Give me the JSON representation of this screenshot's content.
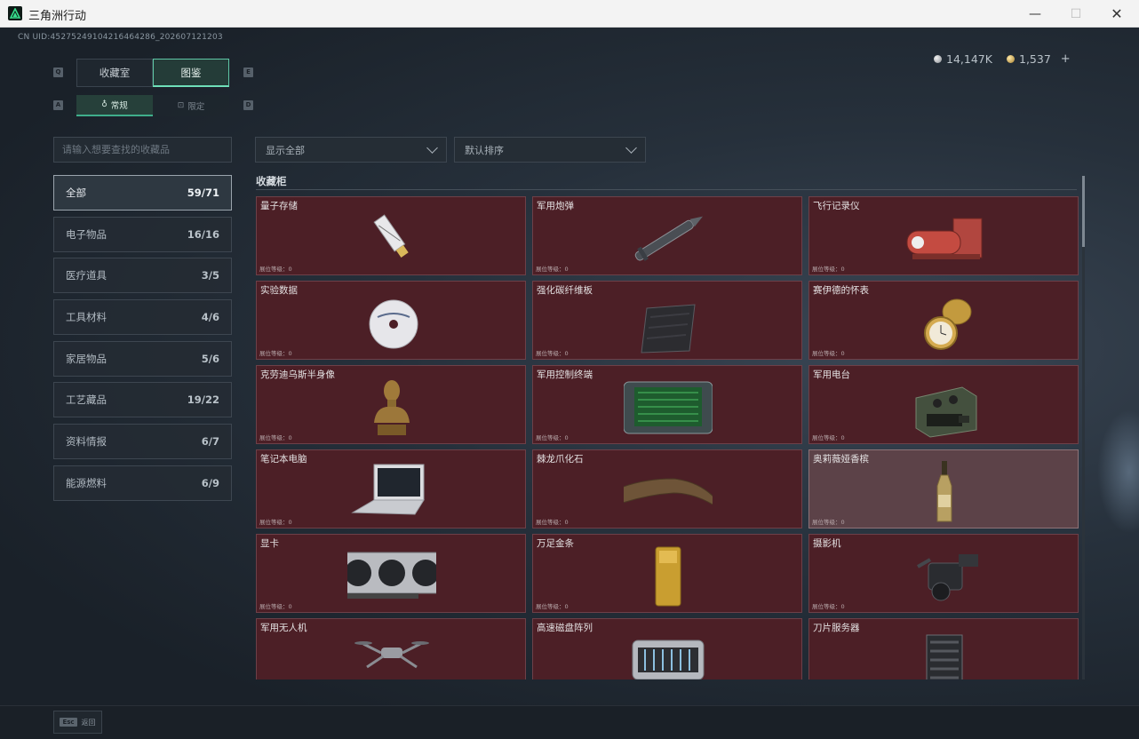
{
  "window": {
    "title": "三角洲行动",
    "min": "—",
    "max": "☐",
    "close": "✕"
  },
  "uid": "CN UID:45275249104216464286_202607121203",
  "currency": [
    {
      "value": "14,147K",
      "type": "silver"
    },
    {
      "value": "1,537",
      "type": "gold",
      "plus": "+"
    }
  ],
  "keybinds": {
    "q": "Q",
    "e": "E",
    "a": "A",
    "d": "D"
  },
  "tabs": [
    {
      "label": "收藏室"
    },
    {
      "label": "图鉴",
      "active": true
    }
  ],
  "subtabs": [
    {
      "label": "常规",
      "icon": "♁",
      "active": true
    },
    {
      "label": "限定",
      "icon": "⊡"
    }
  ],
  "search": {
    "placeholder": "请输入想要查找的收藏品"
  },
  "categories": [
    {
      "label": "全部",
      "count": "59/71",
      "active": true
    },
    {
      "label": "电子物品",
      "count": "16/16"
    },
    {
      "label": "医疗道具",
      "count": "3/5"
    },
    {
      "label": "工具材料",
      "count": "4/6"
    },
    {
      "label": "家居物品",
      "count": "5/6"
    },
    {
      "label": "工艺藏品",
      "count": "19/22"
    },
    {
      "label": "资料情报",
      "count": "6/7"
    },
    {
      "label": "能源燃料",
      "count": "6/9"
    }
  ],
  "filters": {
    "display": "显示全部",
    "sort": "默认排序"
  },
  "section_title": "收藏柜",
  "level_label": "展位等级：0",
  "items": [
    {
      "name": "量子存储",
      "icon": "usb-drive"
    },
    {
      "name": "军用炮弹",
      "icon": "shell"
    },
    {
      "name": "飞行记录仪",
      "icon": "flight-recorder"
    },
    {
      "name": "实验数据",
      "icon": "disc"
    },
    {
      "name": "强化碳纤维板",
      "icon": "carbon-plate"
    },
    {
      "name": "赛伊德的怀表",
      "icon": "pocket-watch"
    },
    {
      "name": "克劳迪乌斯半身像",
      "icon": "bust"
    },
    {
      "name": "军用控制终端",
      "icon": "terminal"
    },
    {
      "name": "军用电台",
      "icon": "radio"
    },
    {
      "name": "笔记本电脑",
      "icon": "laptop"
    },
    {
      "name": "棘龙爪化石",
      "icon": "claw"
    },
    {
      "name": "奥莉薇娅香槟",
      "icon": "champagne",
      "selected": true
    },
    {
      "name": "显卡",
      "icon": "gpu"
    },
    {
      "name": "万足金条",
      "icon": "gold-bar"
    },
    {
      "name": "摄影机",
      "icon": "camera"
    },
    {
      "name": "军用无人机",
      "icon": "drone"
    },
    {
      "name": "高速磁盘阵列",
      "icon": "disk-array"
    },
    {
      "name": "刀片服务器",
      "icon": "server"
    }
  ],
  "footer": {
    "key": "Esc",
    "label": "返回"
  }
}
